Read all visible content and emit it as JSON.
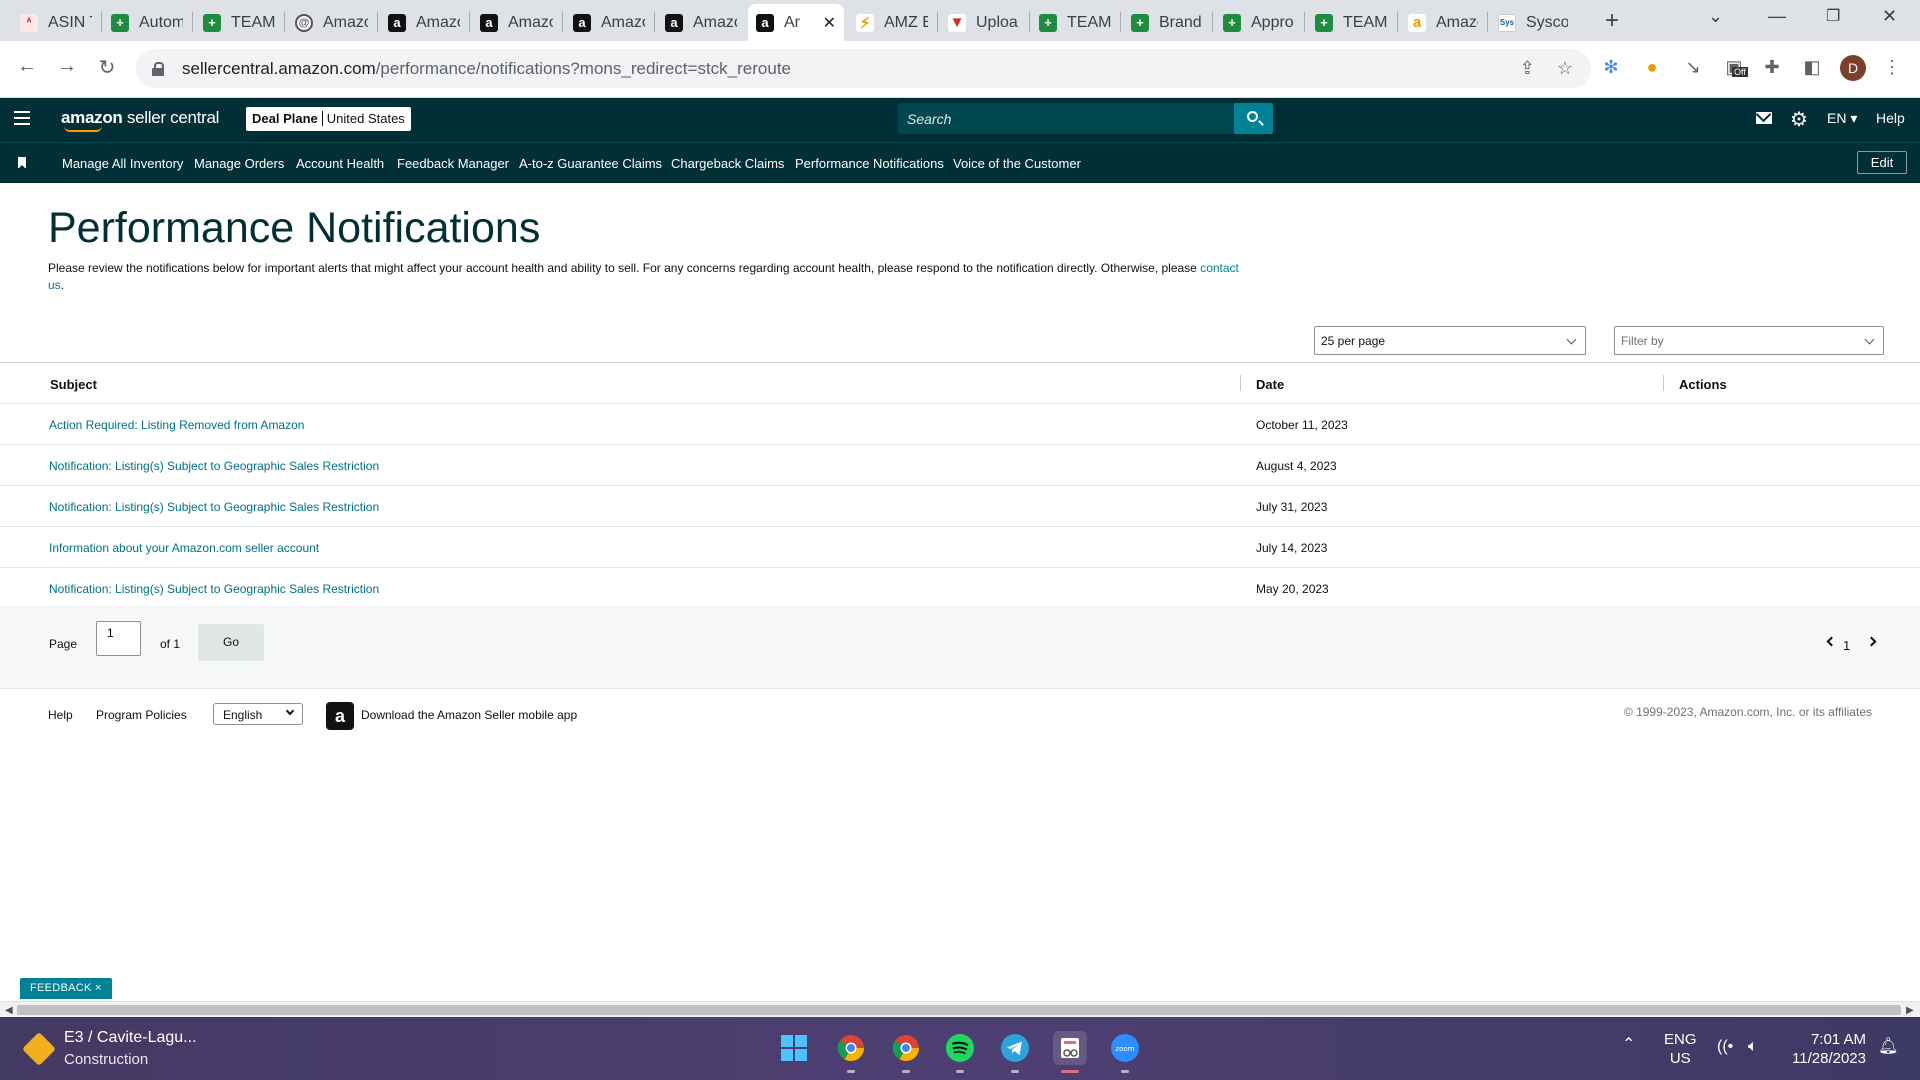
{
  "browser": {
    "tabs": [
      {
        "label": "ASIN T",
        "icon": "asin-icon"
      },
      {
        "label": "Autom",
        "icon": "sheets-icon"
      },
      {
        "label": "TEAM",
        "icon": "sheets-icon"
      },
      {
        "label": "Amazo",
        "icon": "at-icon"
      },
      {
        "label": "Amazo",
        "icon": "amazon-icon"
      },
      {
        "label": "Amazo",
        "icon": "amazon-icon"
      },
      {
        "label": "Amazo",
        "icon": "amazon-icon"
      },
      {
        "label": "Amazo",
        "icon": "amazon-icon"
      },
      {
        "label": "Ar",
        "icon": "amazon-icon",
        "active": true
      },
      {
        "label": "AMZ E",
        "icon": "amz-icon"
      },
      {
        "label": "Uploa",
        "icon": "upload-icon"
      },
      {
        "label": "TEAM",
        "icon": "sheets-icon"
      },
      {
        "label": "Brand",
        "icon": "sheets-icon"
      },
      {
        "label": "Appro",
        "icon": "sheets-icon"
      },
      {
        "label": "TEAM",
        "icon": "sheets-icon"
      },
      {
        "label": "Amazo",
        "icon": "amazon-smile-icon"
      },
      {
        "label": "Sysco",
        "icon": "sysco-icon"
      }
    ],
    "url_host": "sellercentral.amazon.com",
    "url_path": "/performance/notifications?mons_redirect=stck_reroute",
    "avatar_initial": "D",
    "ext_badge": "Off"
  },
  "header": {
    "logo_bold": "amazon",
    "logo_light": " seller central",
    "store_name": "Deal Plane",
    "store_region": "United States",
    "search_placeholder": "Search",
    "language": "EN",
    "help": "Help"
  },
  "bookmarks": {
    "items": [
      "Manage All Inventory",
      "Manage Orders",
      "Account Health",
      "Feedback Manager",
      "A-to-z Guarantee Claims",
      "Chargeback Claims",
      "Performance Notifications",
      "Voice of the Customer"
    ],
    "edit": "Edit"
  },
  "main": {
    "title": "Performance Notifications",
    "description": "Please review the notifications below for important alerts that might affect your account health and ability to sell. For any concerns regarding account health, please respond to the notification directly. Otherwise, please ",
    "contact_link": "contact us",
    "description_end": ".",
    "per_page": "25 per page",
    "filter_placeholder": "Filter by",
    "columns": {
      "subject": "Subject",
      "date": "Date",
      "actions": "Actions"
    },
    "rows": [
      {
        "subject": "Action Required: Listing Removed from Amazon",
        "date": "October 11, 2023"
      },
      {
        "subject": "Notification: Listing(s) Subject to Geographic Sales Restriction",
        "date": "August 4, 2023"
      },
      {
        "subject": "Notification: Listing(s) Subject to Geographic Sales Restriction",
        "date": "July 31, 2023"
      },
      {
        "subject": "Information about your Amazon.com seller account",
        "date": "July 14, 2023"
      },
      {
        "subject": "Notification: Listing(s) Subject to Geographic Sales Restriction",
        "date": "May 20, 2023"
      }
    ],
    "pager": {
      "page_label": "Page",
      "page_value": "1",
      "of_label": "of 1",
      "go": "Go",
      "current": "1"
    }
  },
  "footer": {
    "help": "Help",
    "policies": "Program Policies",
    "language": "English",
    "app_text": "Download the Amazon Seller mobile app",
    "copyright": "© 1999-2023, Amazon.com, Inc. or its affiliates"
  },
  "feedback": "FEEDBACK ×",
  "taskbar": {
    "weather_title": "E3 / Cavite-Lagu...",
    "weather_sub": "Construction",
    "lang_line1": "ENG",
    "lang_line2": "US",
    "time": "7:01 AM",
    "date": "11/28/2023"
  },
  "colors": {
    "header_bg": "#002f36",
    "link": "#007185",
    "accent": "#008296"
  }
}
